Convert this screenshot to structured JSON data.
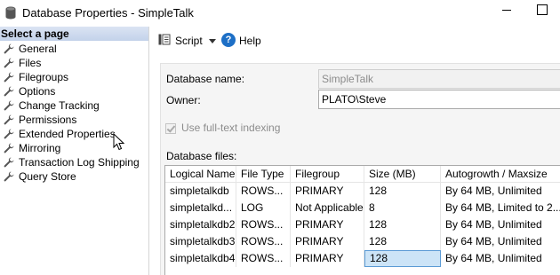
{
  "window": {
    "title": "Database Properties - SimpleTalk"
  },
  "sidebar": {
    "heading": "Select a page",
    "items": [
      {
        "label": "General"
      },
      {
        "label": "Files"
      },
      {
        "label": "Filegroups"
      },
      {
        "label": "Options"
      },
      {
        "label": "Change Tracking"
      },
      {
        "label": "Permissions"
      },
      {
        "label": "Extended Properties"
      },
      {
        "label": "Mirroring"
      },
      {
        "label": "Transaction Log Shipping"
      },
      {
        "label": "Query Store"
      }
    ]
  },
  "toolbar": {
    "script_label": "Script",
    "help_label": "Help"
  },
  "form": {
    "database_name_label": "Database name:",
    "database_name_value": "SimpleTalk",
    "owner_label": "Owner:",
    "owner_value": "PLATO\\Steve",
    "fulltext_label": "Use full-text indexing",
    "database_files_label": "Database files:"
  },
  "files_grid": {
    "columns": [
      "Logical Name",
      "File Type",
      "Filegroup",
      "Size (MB)",
      "Autogrowth / Maxsize"
    ],
    "rows": [
      [
        "simpletalkdb",
        "ROWS...",
        "PRIMARY",
        "128",
        "By 64 MB, Unlimited"
      ],
      [
        "simpletalkd...",
        "LOG",
        "Not Applicable",
        "8",
        "By 64 MB, Limited to 2..."
      ],
      [
        "simpletalkdb2",
        "ROWS...",
        "PRIMARY",
        "128",
        "By 64 MB, Unlimited"
      ],
      [
        "simpletalkdb3",
        "ROWS...",
        "PRIMARY",
        "128",
        "By 64 MB, Unlimited"
      ],
      [
        "simpletalkdb4",
        "ROWS...",
        "PRIMARY",
        "128",
        "By 64 MB, Unlimited"
      ]
    ]
  },
  "icons": {
    "app": "database-icon",
    "nav": "wrench-icon",
    "script": "script-icon",
    "help": "help-icon"
  },
  "colors": {
    "heading_bg": "#c3d2ea",
    "selection_bg": "#cce4f7",
    "selection_border": "#5b9bd5",
    "help_blue": "#1d6fc6"
  }
}
